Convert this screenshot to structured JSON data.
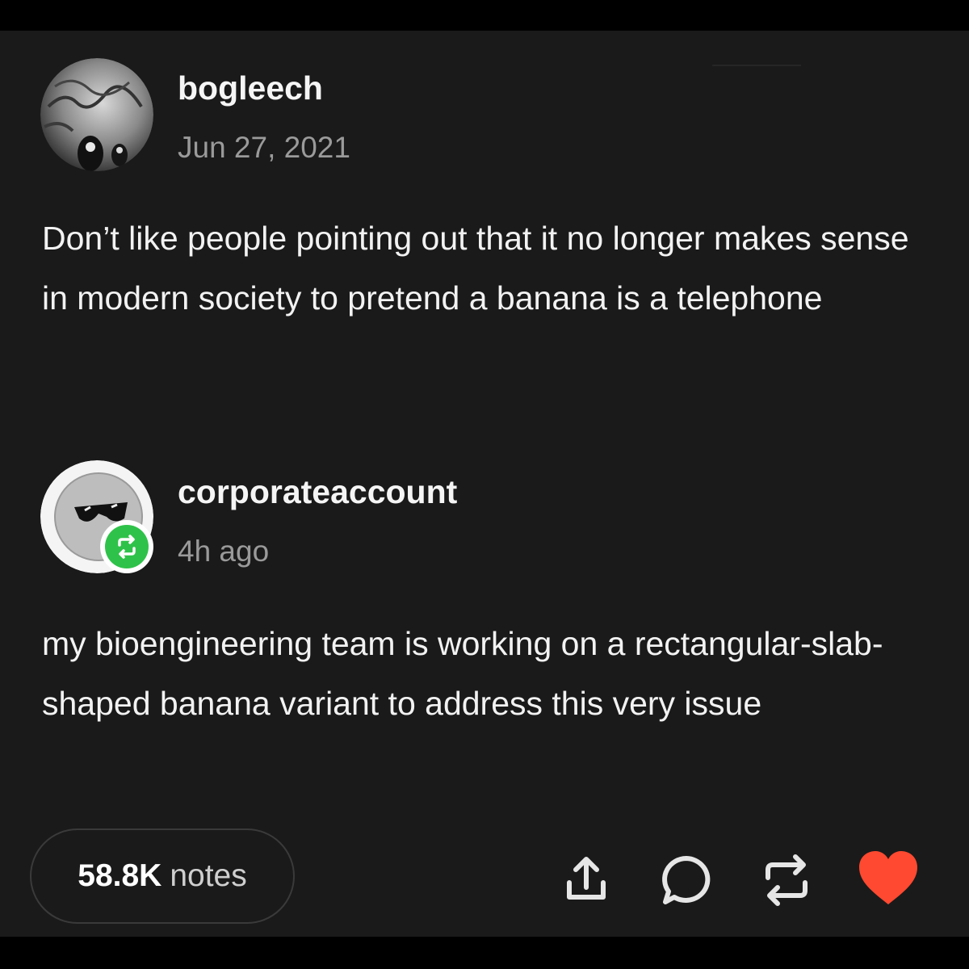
{
  "post": {
    "author": {
      "username": "bogleech",
      "date": "Jun 27, 2021"
    },
    "body": "Don’t like people pointing out that it no longer makes sense in modern society to pretend a banana is a telephone"
  },
  "reblog": {
    "author": {
      "username": "corporateaccount",
      "time": "4h ago"
    },
    "body": "my bioengineering team is working on a rectangular-slab-shaped banana variant to address this very issue",
    "badge_icon": "reblog-icon"
  },
  "footer": {
    "notes_count": "58.8K",
    "notes_label": "notes",
    "actions": [
      {
        "icon": "share-icon"
      },
      {
        "icon": "reply-icon"
      },
      {
        "icon": "reblog-icon"
      },
      {
        "icon": "heart-icon"
      }
    ]
  },
  "colors": {
    "background": "#1a1a1a",
    "reblog_badge": "#2fc24a",
    "like": "#ff4930",
    "icon": "#e6e6e6"
  }
}
